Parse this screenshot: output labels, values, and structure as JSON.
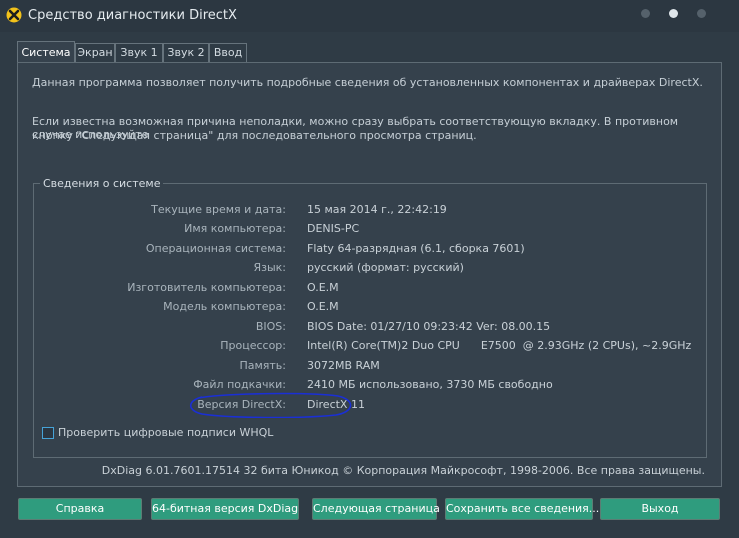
{
  "window": {
    "title": "Средство диагностики DirectX"
  },
  "tabs": [
    {
      "label": "Система",
      "active": true
    },
    {
      "label": "Экран",
      "active": false
    },
    {
      "label": "Звук 1",
      "active": false
    },
    {
      "label": "Звук 2",
      "active": false
    },
    {
      "label": "Ввод",
      "active": false
    }
  ],
  "intro": {
    "line1": "Данная программа позволяет получить подробные сведения об установленных компонентах и драйверах DirectX.",
    "line2": "Если известна возможная причина неполадки, можно сразу выбрать соответствующую вкладку. В противном случае используйте",
    "line3": "кнопку \"Следующая страница\" для последовательного просмотра страниц."
  },
  "system_info": {
    "group_title": "Сведения о системе",
    "rows": [
      {
        "label": "Текущие время и дата:",
        "value": "15 мая 2014 г., 22:42:19"
      },
      {
        "label": "Имя компьютера:",
        "value": "DENIS-PC"
      },
      {
        "label": "Операционная система:",
        "value": "Flaty 64-разрядная (6.1, сборка 7601)"
      },
      {
        "label": "Язык:",
        "value": "русский (формат: русский)"
      },
      {
        "label": "Изготовитель компьютера:",
        "value": "O.E.M"
      },
      {
        "label": "Модель компьютера:",
        "value": "O.E.M"
      },
      {
        "label": "BIOS:",
        "value": "BIOS Date: 01/27/10 09:23:42 Ver: 08.00.15"
      },
      {
        "label": "Процессор:",
        "value": "Intel(R) Core(TM)2 Duo CPU      E7500  @ 2.93GHz (2 CPUs), ~2.9GHz"
      },
      {
        "label": "Память:",
        "value": "3072MB RAM"
      },
      {
        "label": "Файл подкачки:",
        "value": "2410 МБ использовано, 3730 МБ свободно"
      },
      {
        "label": "Версия DirectX:",
        "value": "DirectX 11"
      }
    ],
    "whql_label": "Проверить цифровые подписи WHQL"
  },
  "footer": {
    "info": "DxDiag 6.01.7601.17514 32 бита Юникод  © Корпорация Майкрософт, 1998-2006.  Все права защищены."
  },
  "buttons": {
    "help": "Справка",
    "dxdiag64": "64-битная версия DxDiag",
    "next_page": "Следующая страница",
    "save_all": "Сохранить все сведения...",
    "exit": "Выход"
  },
  "colors": {
    "accent_button": "#2f9c7e",
    "highlight_ellipse": "#1a2fd6",
    "background": "#2f3b45"
  },
  "icons": {
    "app": "directx-x-icon",
    "window_controls": [
      "minimize-dot-icon",
      "maximize-dot-icon",
      "close-dot-icon"
    ]
  }
}
